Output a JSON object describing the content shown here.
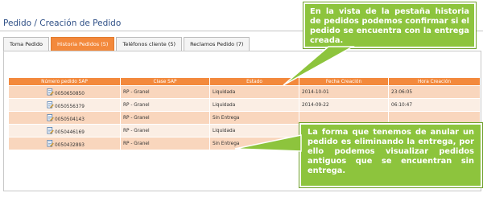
{
  "page_title": "Pedido / Creación de Pedido",
  "tabs": [
    {
      "label": "Toma Pedido",
      "active": false
    },
    {
      "label": "Historia Pedidos (5)",
      "active": true
    },
    {
      "label": "Teléfonos cliente (5)",
      "active": false
    },
    {
      "label": "Reclamos Pedido (7)",
      "active": false
    }
  ],
  "table": {
    "headers": [
      "Número pedido SAP",
      "Clase SAP",
      "Estado",
      "Fecha Creación",
      "Hora Creación"
    ],
    "rows": [
      {
        "numero": "0050650850",
        "clase": "RP - Granel",
        "estado": "Liquidada",
        "fecha": "2014-10-01",
        "hora": "23:06:05"
      },
      {
        "numero": "0050556379",
        "clase": "RP - Granel",
        "estado": "Liquidada",
        "fecha": "2014-09-22",
        "hora": "06:10:47"
      },
      {
        "numero": "0050504143",
        "clase": "RP - Granel",
        "estado": "Sin Entrega",
        "fecha": "",
        "hora": ""
      },
      {
        "numero": "0050446169",
        "clase": "RP - Granel",
        "estado": "Liquidada",
        "fecha": "",
        "hora": ""
      },
      {
        "numero": "0050432893",
        "clase": "RP - Granel",
        "estado": "Sin Entrega",
        "fecha": "",
        "hora": ""
      }
    ]
  },
  "callouts": {
    "top": "En la vista de la pestaña historia de pedidos podemos confirmar si el pedido se encuentra con la entrega creada.",
    "bottom": "La forma que tenemos de anular un pedido es eliminando la entrega, por ello podemos visualizar pedidos antiguos que se encuentran sin entrega."
  },
  "colors": {
    "accent_orange": "#f3893c",
    "row_dark": "#f9d6bd",
    "row_light": "#fbeee4",
    "callout_green": "#8dc43d",
    "title_blue": "#2e4f86"
  },
  "icons": {
    "order_row": "document-edit-icon"
  }
}
